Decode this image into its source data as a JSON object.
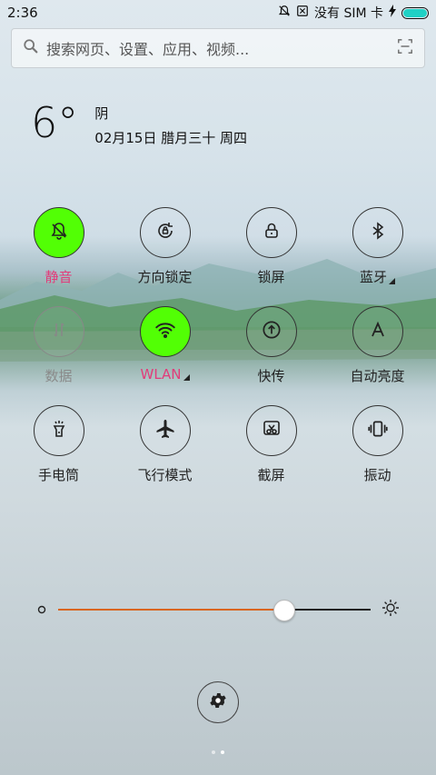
{
  "status": {
    "time": "2:36",
    "no_sim": "没有 SIM 卡",
    "icons": [
      "bell-off-icon",
      "sim-x-icon",
      "charging-bolt-icon",
      "battery-icon"
    ],
    "battery_level": 1.0,
    "battery_color": "#1fd1c5"
  },
  "search": {
    "placeholder": "搜索网页、设置、应用、视频..."
  },
  "weather": {
    "temp": "6°",
    "condition": "阴",
    "date": "02月15日 腊月三十 周四"
  },
  "toggles": [
    {
      "label": "静音",
      "icon": "bell-off-icon",
      "state": "on"
    },
    {
      "label": "方向锁定",
      "icon": "rotation-lock-icon",
      "state": "off"
    },
    {
      "label": "锁屏",
      "icon": "lock-icon",
      "state": "off"
    },
    {
      "label": "蓝牙",
      "icon": "bluetooth-icon",
      "state": "off",
      "expandable": true
    },
    {
      "label": "数据",
      "icon": "data-arrows-icon",
      "state": "disabled"
    },
    {
      "label": "WLAN",
      "icon": "wifi-icon",
      "state": "on",
      "expandable": true
    },
    {
      "label": "快传",
      "icon": "transfer-icon",
      "state": "off"
    },
    {
      "label": "自动亮度",
      "icon": "auto-brightness-icon",
      "state": "off"
    },
    {
      "label": "手电筒",
      "icon": "flashlight-icon",
      "state": "off"
    },
    {
      "label": "飞行模式",
      "icon": "airplane-icon",
      "state": "off"
    },
    {
      "label": "截屏",
      "icon": "screenshot-icon",
      "state": "off"
    },
    {
      "label": "振动",
      "icon": "vibrate-icon",
      "state": "off"
    }
  ],
  "brightness": {
    "level": 0.72,
    "fill_color": "#d9661f"
  },
  "colors": {
    "active_toggle": "#52ff05",
    "active_label": "#e23b7a"
  },
  "pager": {
    "pages": 2,
    "current": 2
  }
}
